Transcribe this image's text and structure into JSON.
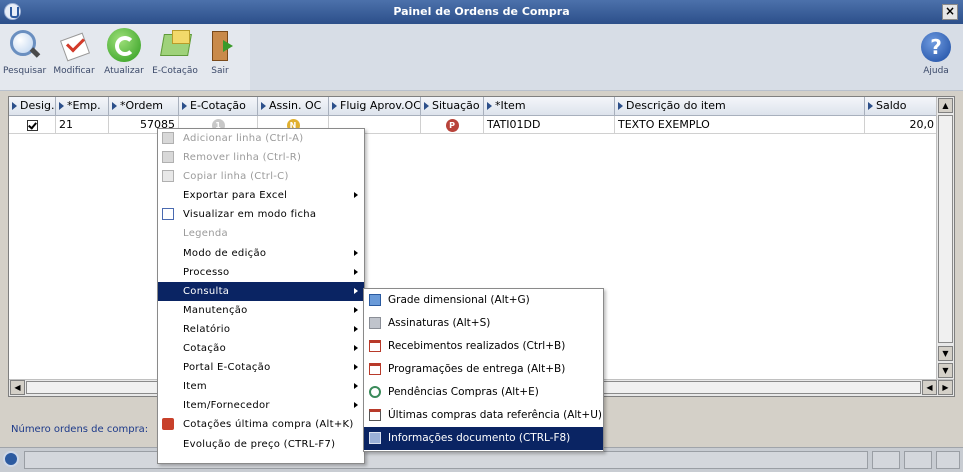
{
  "window": {
    "title": "Painel de Ordens de Compra"
  },
  "toolbar": {
    "search": "Pesquisar",
    "modify": "Modificar",
    "refresh": "Atualizar",
    "ecotacao": "E-Cotação",
    "exit": "Sair",
    "help": "Ajuda"
  },
  "grid": {
    "columns": [
      "Desig.",
      "*Emp.",
      "*Ordem",
      "E-Cotação",
      "Assin. OC",
      "Fluig Aprov.OC",
      "Situação",
      "*Item",
      "Descrição do item",
      "Saldo"
    ],
    "row": {
      "emp": "21",
      "ordem": "57085",
      "ecotacao_icon": "1",
      "assin_icon": "N",
      "situacao_icon": "P",
      "item": "TATI01DD",
      "descricao": "TEXTO EXEMPLO",
      "saldo": "20,0"
    }
  },
  "footer": {
    "label": "Número ordens de compra:"
  },
  "context_menu": {
    "items": [
      {
        "label": "Adicionar linha (Ctrl-A)",
        "disabled": true,
        "icon": "add-row-icon"
      },
      {
        "label": "Remover linha (Ctrl-R)",
        "disabled": true,
        "icon": "remove-row-icon"
      },
      {
        "label": "Copiar linha (Ctrl-C)",
        "disabled": true,
        "icon": "copy-row-icon"
      },
      {
        "label": "Exportar para Excel",
        "submenu": true
      },
      {
        "label": "Visualizar em modo ficha",
        "icon": "form-view-icon"
      },
      {
        "label": "Legenda",
        "disabled": true
      },
      {
        "label": "Modo de edição",
        "submenu": true
      },
      {
        "label": "Processo",
        "submenu": true
      },
      {
        "label": "Consulta",
        "submenu": true,
        "selected": true
      },
      {
        "label": "Manutenção",
        "submenu": true
      },
      {
        "label": "Relatório",
        "submenu": true
      },
      {
        "label": "Cotação",
        "submenu": true
      },
      {
        "label": "Portal E-Cotação",
        "submenu": true
      },
      {
        "label": "Item",
        "submenu": true
      },
      {
        "label": "Item/Fornecedor",
        "submenu": true
      },
      {
        "label": "Cotações última compra (Alt+K)",
        "icon": "quotes-icon"
      },
      {
        "label": "Evolução de preço (CTRL-F7)"
      }
    ]
  },
  "submenu": {
    "items": [
      {
        "label": "Grade dimensional (Alt+G)",
        "icon": "cube-icon"
      },
      {
        "label": "Assinaturas (Alt+S)",
        "icon": "signature-icon"
      },
      {
        "label": "Recebimentos realizados (Ctrl+B)",
        "icon": "calendar-icon"
      },
      {
        "label": "Programações de entrega (Alt+B)",
        "icon": "calendar-icon"
      },
      {
        "label": "Pendências Compras (Alt+E)",
        "icon": "clock-icon"
      },
      {
        "label": "Últimas compras data referência (Alt+U)",
        "icon": "calendar-15-icon"
      },
      {
        "label": "Informações documento (CTRL-F8)",
        "icon": "document-info-icon",
        "selected": true
      }
    ]
  },
  "colors": {
    "titlebar": "#2c4f8a",
    "menu_highlight": "#0a2463"
  }
}
